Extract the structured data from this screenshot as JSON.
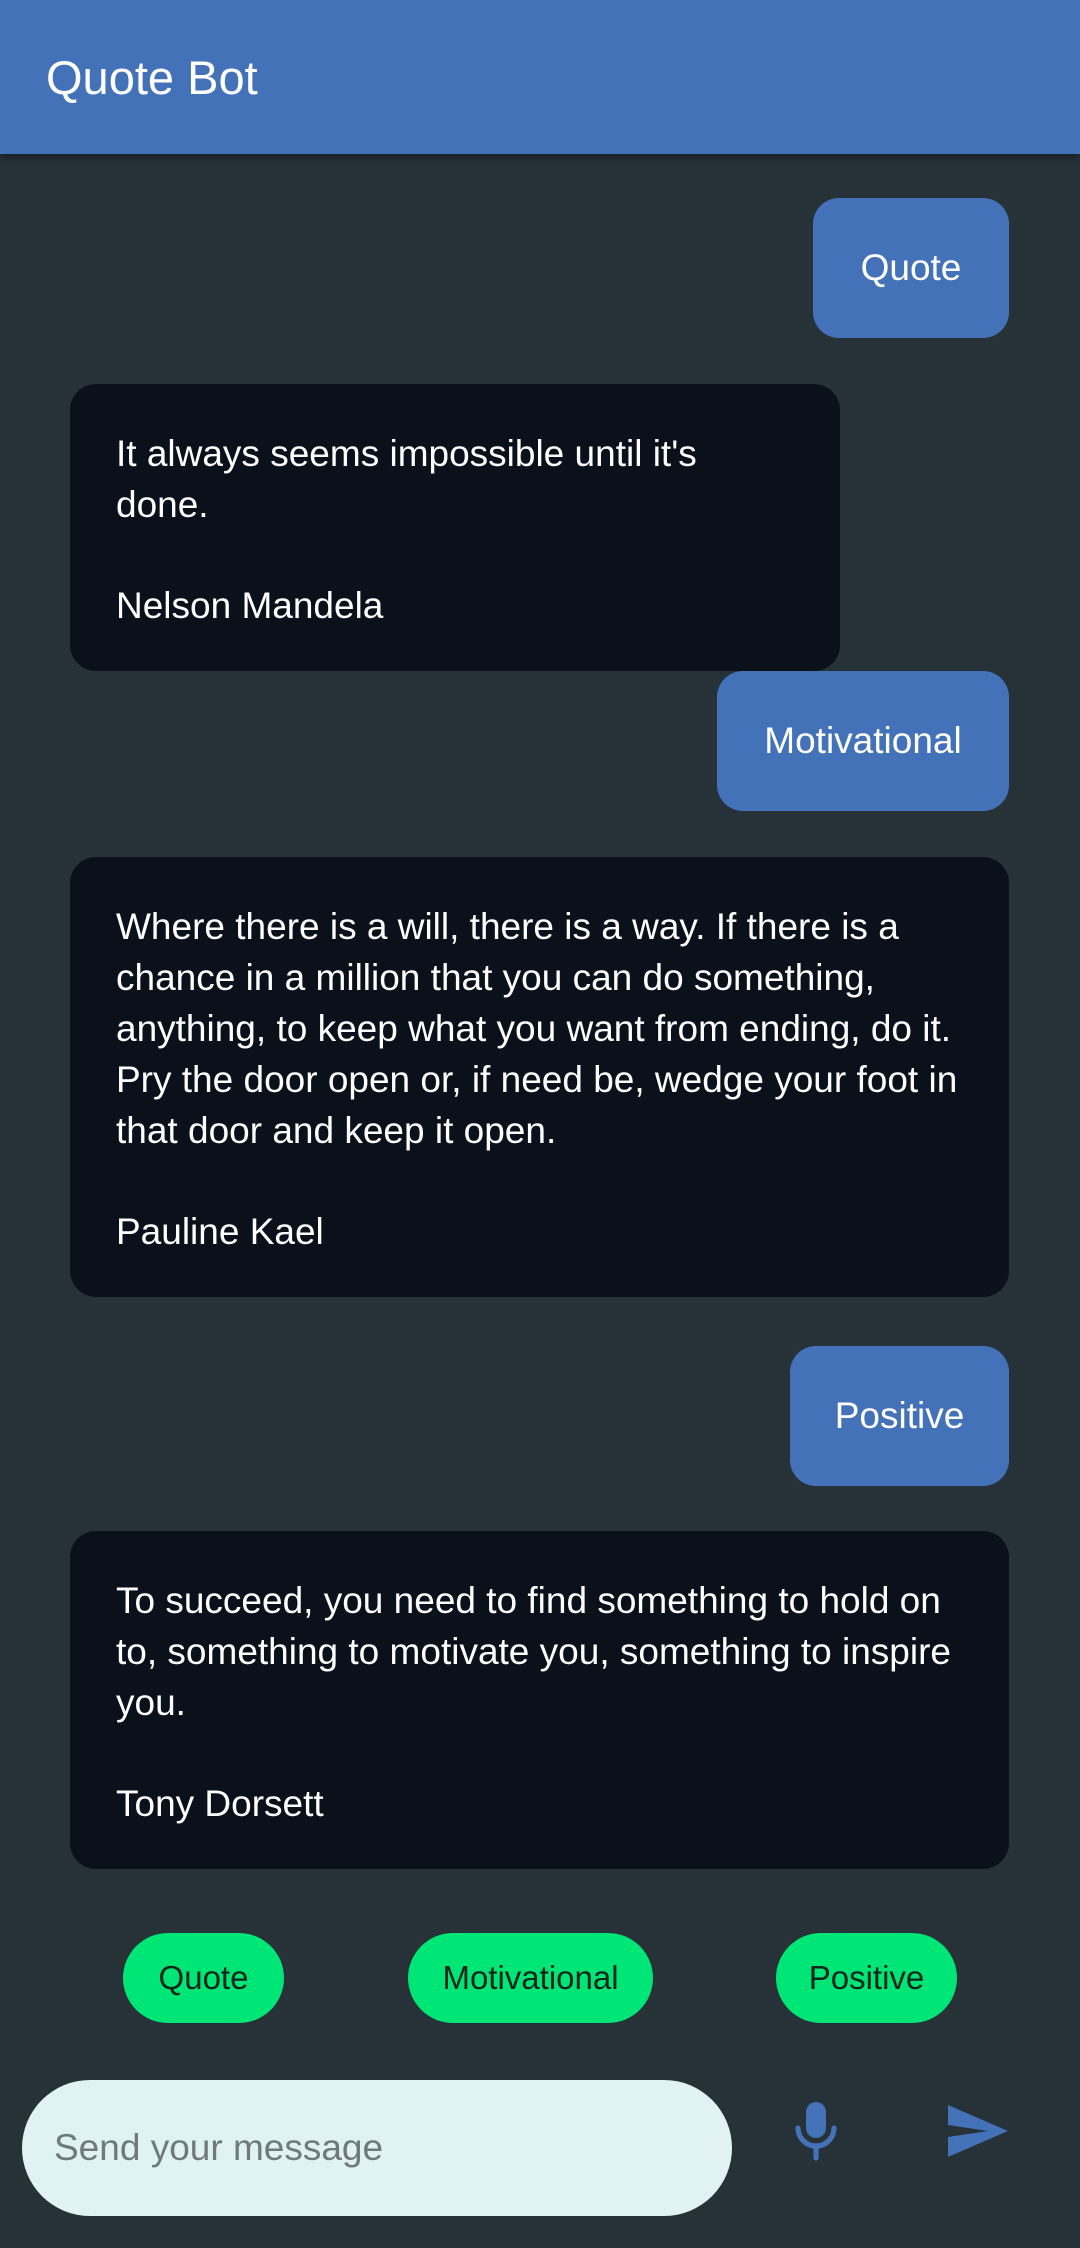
{
  "app_bar": {
    "title": "Quote Bot"
  },
  "messages": [
    {
      "from": "user",
      "text": "Quote"
    },
    {
      "from": "bot",
      "quote": "It always seems impossible until it's done.",
      "author": "Nelson Mandela"
    },
    {
      "from": "user",
      "text": "Motivational"
    },
    {
      "from": "bot",
      "quote": "Where there is a will, there is a way. If there is a chance in a million that you can do something, anything, to keep what you want from ending, do it. Pry the door open or, if need be, wedge your foot in that door and keep it open.",
      "author": "Pauline Kael"
    },
    {
      "from": "user",
      "text": "Positive"
    },
    {
      "from": "bot",
      "quote": "To succeed, you need to find something to hold on to, something to motivate you, something to inspire you.",
      "author": "Tony Dorsett"
    }
  ],
  "suggestions": [
    "Quote",
    "Motivational",
    "Positive"
  ],
  "composer": {
    "placeholder": "Send your message",
    "value": ""
  },
  "icons": {
    "mic": "mic-icon",
    "send": "send-icon"
  },
  "colors": {
    "app_bar": "#4472b8",
    "background": "#263238",
    "user_bubble": "#4472b8",
    "bot_bubble": "#0b111a",
    "chip": "#00e676",
    "composer": "#e0f2f1",
    "icon": "#4472b8"
  }
}
